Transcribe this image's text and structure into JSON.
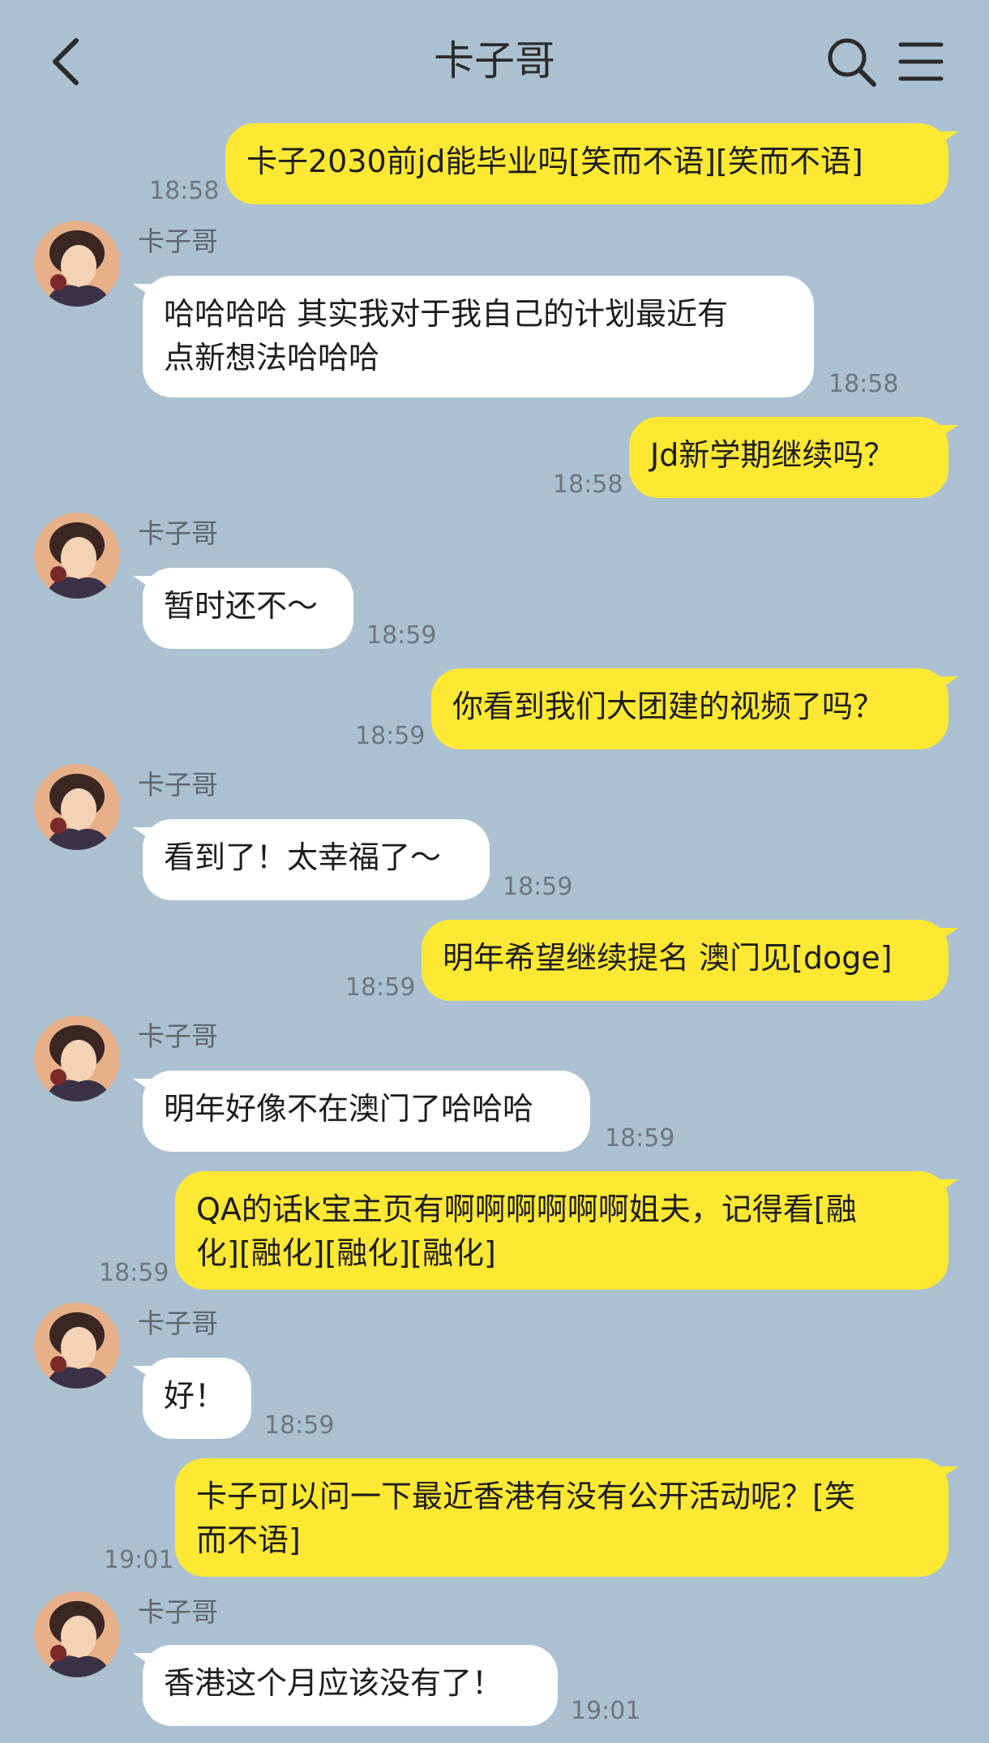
{
  "header": {
    "title": "卡子哥"
  },
  "messages": [
    {
      "text": "卡子2030前jd能毕业吗[笑而不语][笑而不语]",
      "time": "18:58"
    },
    {
      "name": "卡子哥",
      "text": "哈哈哈哈 其实我对于我自己的计划最近有\n点新想法哈哈哈",
      "time": "18:58"
    },
    {
      "text": "Jd新学期继续吗？",
      "time": "18:58"
    },
    {
      "name": "卡子哥",
      "text": "暂时还不～",
      "time": "18:59"
    },
    {
      "text": "你看到我们大团建的视频了吗？",
      "time": "18:59"
    },
    {
      "name": "卡子哥",
      "text": "看到了！太幸福了～",
      "time": "18:59"
    },
    {
      "text": "明年希望继续提名 澳门见[doge]",
      "time": "18:59"
    },
    {
      "name": "卡子哥",
      "text": "明年好像不在澳门了哈哈哈",
      "time": "18:59"
    },
    {
      "text": "QA的话k宝主页有啊啊啊啊啊啊姐夫，记得看[融\n化][融化][融化][融化]",
      "time": "18:59"
    },
    {
      "name": "卡子哥",
      "text": "好！",
      "time": "18:59"
    },
    {
      "text": "卡子可以问一下最近香港有没有公开活动呢？[笑\n而不语]",
      "time": "19:01"
    },
    {
      "name": "卡子哥",
      "text": "香港这个月应该没有了！",
      "time": "19:01"
    }
  ]
}
